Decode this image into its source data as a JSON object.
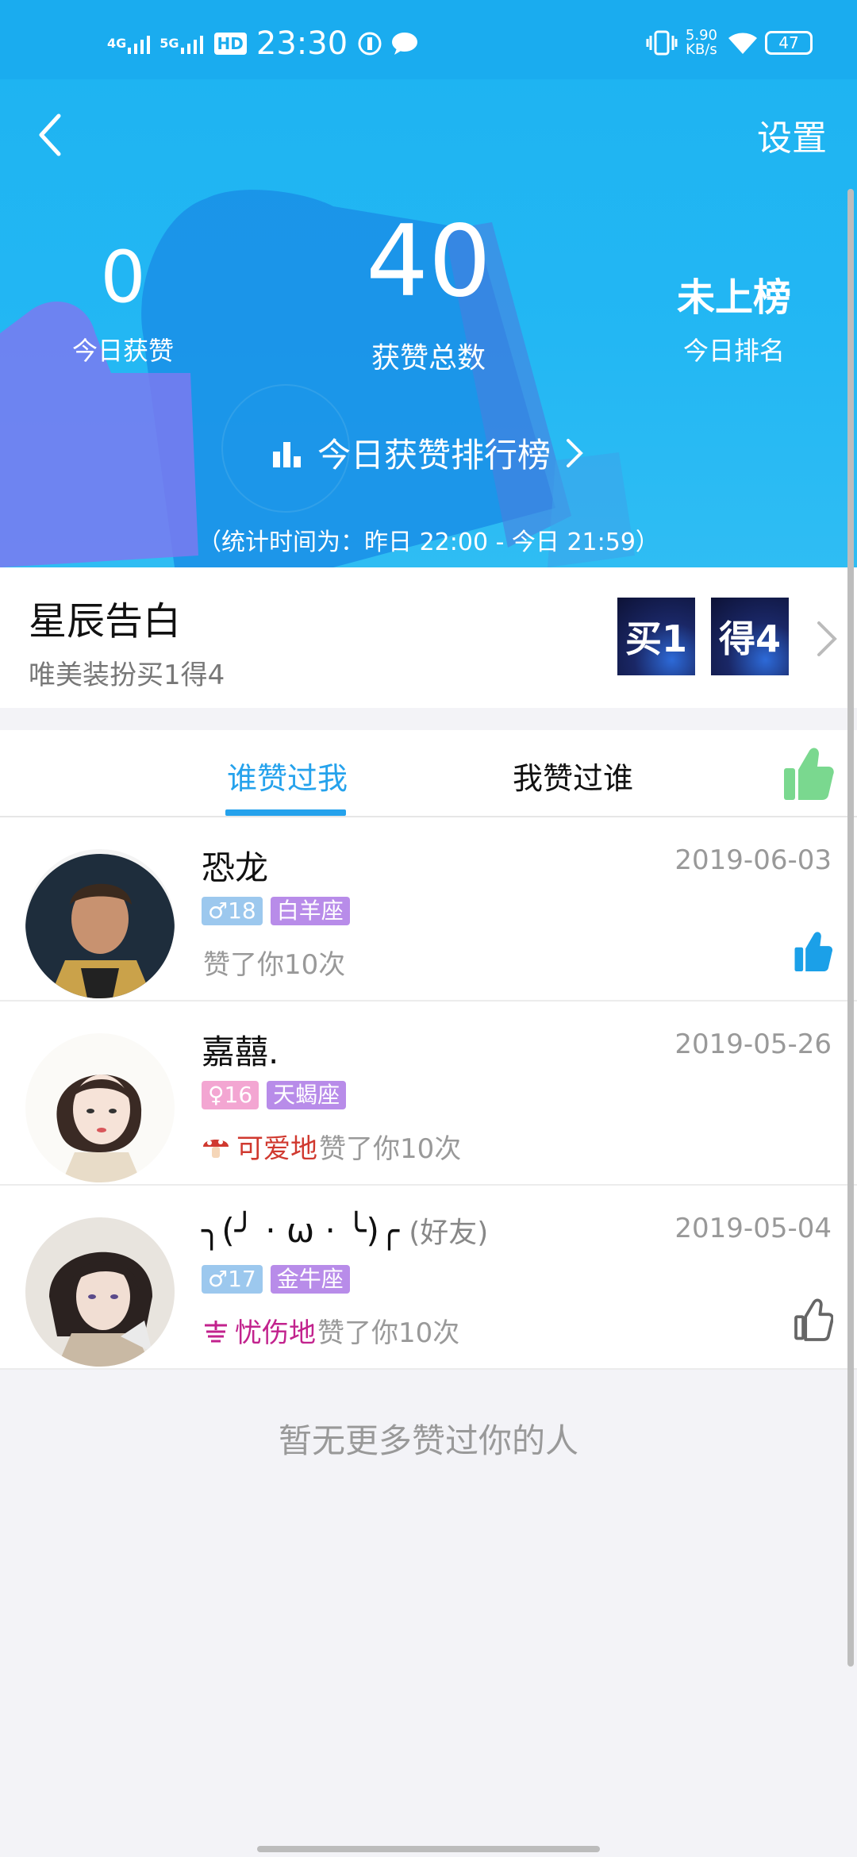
{
  "status_bar": {
    "sig1": "4G",
    "sig2": "5G",
    "hd": "HD",
    "time": "23:30",
    "speed_value": "5.90",
    "speed_unit": "KB/s",
    "battery": "47"
  },
  "header": {
    "settings_label": "设置",
    "stats": [
      {
        "value": "0",
        "label": "今日获赞"
      },
      {
        "value": "40",
        "label": "获赞总数"
      },
      {
        "value": "未上榜",
        "label": "今日排名"
      }
    ],
    "rank_link": "今日获赞排行榜",
    "stat_time": "（统计时间为：昨日 22:00 - 今日 21:59）"
  },
  "promo": {
    "title": "星辰告白",
    "subtitle": "唯美装扮买1得4",
    "badges": [
      "买1",
      "得4"
    ]
  },
  "tabs": {
    "items": [
      "谁赞过我",
      "我赞过谁"
    ],
    "active_index": 0,
    "accent": "#25a2ec"
  },
  "list": [
    {
      "name": "恐龙",
      "friend": "",
      "date": "2019-06-03",
      "gender_age": "♂18",
      "zodiac": "白羊座",
      "prefix": "",
      "prefix_color": "",
      "liked_text": "赞了你10次",
      "thumb": "filled-blue"
    },
    {
      "name": "嘉囍.",
      "friend": "",
      "date": "2019-05-26",
      "gender_age": "♀16",
      "zodiac": "天蝎座",
      "prefix": "可爱地",
      "prefix_color": "#d0392f",
      "liked_text": "赞了你10次",
      "thumb": ""
    },
    {
      "name": "╮(╯ · ω · ╰)╭",
      "friend": "(好友)",
      "date": "2019-05-04",
      "gender_age": "♂17",
      "zodiac": "金牛座",
      "prefix": "忧伤地",
      "prefix_color": "#c2228d",
      "liked_text": "赞了你10次",
      "thumb": "outline-gray"
    }
  ],
  "no_more": "暂无更多赞过你的人"
}
